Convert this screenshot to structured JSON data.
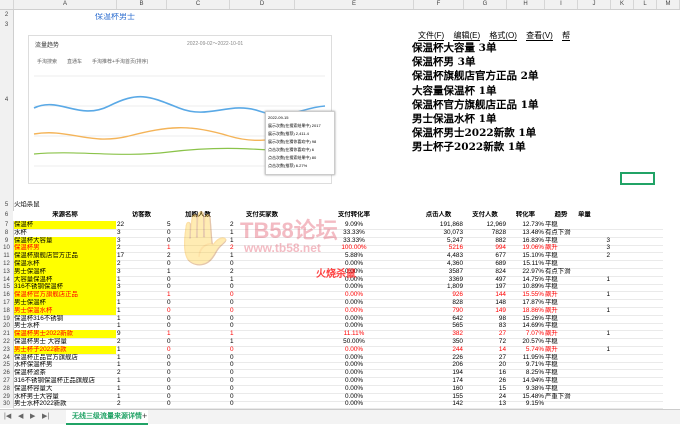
{
  "sheet": {
    "columns": [
      "A",
      "B",
      "C",
      "D",
      "E",
      "F",
      "G",
      "H",
      "I",
      "J",
      "K",
      "L",
      "M"
    ],
    "b2_title": "保温杯男士",
    "a6_label": "火焰杀鼠",
    "watermark_left": "火焰杀鼠",
    "watermark_center": "火烧杀鼠",
    "site_watermark_1": "TB58论坛",
    "site_watermark_2": "www.tb58.net"
  },
  "chart": {
    "title": "流量趋势",
    "date_range": "2022-09-02～2022-10-01",
    "legend": [
      "手淘搜索",
      "直通车",
      "手淘推荐+手淘首页(排序)"
    ],
    "tooltip_title": "2022-09-15",
    "tooltip_rows": [
      {
        "label": "展示次数(在搜索结果中)",
        "value": "2017"
      },
      {
        "label": "展示次数(推荐)",
        "value": "2,411.4"
      },
      {
        "label": "展示次数(在猜你喜欢中)",
        "value": "98"
      },
      {
        "label": "点击次数(在猜你喜欢中)",
        "value": "6"
      },
      {
        "label": "点击次数(在搜索结果中)",
        "value": "80"
      },
      {
        "label": "点击次数(推荐)",
        "value": "6.27%"
      }
    ]
  },
  "menu": [
    "文件(F)",
    "编辑(E)",
    "格式(O)",
    "查看(V)",
    "帮"
  ],
  "notes": [
    "保温杯大容量  3单",
    "保温杯男   3单",
    "保温杯旗舰店官方正品  2单",
    "大容量保温杯  1单",
    "保温杯官方旗舰店正品  1单",
    "男士保温水杯  1单",
    "保温杯男士2022新款  1单",
    "男士杯子2022新款  1单"
  ],
  "headers": {
    "source": "来源名称",
    "visitors": "访客数",
    "cart": "加购人数",
    "buyers": "支付买家数",
    "conv": "支付转化率",
    "clicks": "点击人数",
    "pay_amount": "支付人数",
    "rate": "转化率",
    "trend": "趋势",
    "orders": "单量"
  },
  "rows": [
    {
      "n": "7",
      "source": "保温杯",
      "visitors": "22",
      "cart": "5",
      "buyers": "2",
      "conv": "9.09%",
      "clicks": "191,868",
      "pay": "12,969",
      "rate": "12.73%",
      "trend": "平稳",
      "orders": "",
      "hl": true,
      "red": false
    },
    {
      "n": "8",
      "source": "水杯",
      "visitors": "3",
      "cart": "0",
      "buyers": "1",
      "conv": "33.33%",
      "clicks": "30,073",
      "pay": "7828",
      "rate": "13.48%",
      "trend": "有点下滑",
      "orders": "",
      "hl": false,
      "red": false
    },
    {
      "n": "9",
      "source": "保温杯大容量",
      "visitors": "3",
      "cart": "0",
      "buyers": "1",
      "conv": "33.33%",
      "clicks": "5,247",
      "pay": "882",
      "rate": "16.83%",
      "trend": "平稳",
      "orders": "3",
      "hl": true,
      "red": false
    },
    {
      "n": "10",
      "source": "保温杯男",
      "visitors": "2",
      "cart": "1",
      "buyers": "2",
      "conv": "100.00%",
      "clicks": "5216",
      "pay": "994",
      "rate": "19.06%",
      "trend": "飙升",
      "orders": "3",
      "hl": true,
      "red": true
    },
    {
      "n": "11",
      "source": "保温杯旗舰店官方正品",
      "visitors": "17",
      "cart": "2",
      "buyers": "1",
      "conv": "5.88%",
      "clicks": "4,483",
      "pay": "677",
      "rate": "15.10%",
      "trend": "平稳",
      "orders": "2",
      "hl": true,
      "red": false
    },
    {
      "n": "12",
      "source": "保温水杯",
      "visitors": "2",
      "cart": "0",
      "buyers": "0",
      "conv": "0.00%",
      "clicks": "4,360",
      "pay": "689",
      "rate": "15.11%",
      "trend": "平稳",
      "orders": "",
      "hl": true,
      "red": false
    },
    {
      "n": "13",
      "source": "男士保温杯",
      "visitors": "3",
      "cart": "1",
      "buyers": "2",
      "conv": "0.00%",
      "clicks": "3587",
      "pay": "824",
      "rate": "22.97%",
      "trend": "有点下滑",
      "orders": "",
      "hl": true,
      "red": false
    },
    {
      "n": "14",
      "source": "大容量保温杯",
      "visitors": "1",
      "cart": "0",
      "buyers": "1",
      "conv": "0.00%",
      "clicks": "3369",
      "pay": "497",
      "rate": "14.75%",
      "trend": "平稳",
      "orders": "1",
      "hl": true,
      "red": false
    },
    {
      "n": "15",
      "source": "316不锈钢保温杯",
      "visitors": "3",
      "cart": "0",
      "buyers": "0",
      "conv": "0.00%",
      "clicks": "1,809",
      "pay": "197",
      "rate": "10.89%",
      "trend": "平稳",
      "orders": "",
      "hl": true,
      "red": false
    },
    {
      "n": "16",
      "source": "保温杯官方旗舰店正品",
      "visitors": "3",
      "cart": "1",
      "buyers": "0",
      "conv": "0.00%",
      "clicks": "926",
      "pay": "144",
      "rate": "15.55%",
      "trend": "飙升",
      "orders": "1",
      "hl": true,
      "red": true
    },
    {
      "n": "17",
      "source": "男士保温杯",
      "visitors": "1",
      "cart": "0",
      "buyers": "0",
      "conv": "0.00%",
      "clicks": "828",
      "pay": "148",
      "rate": "17.87%",
      "trend": "平稳",
      "orders": "",
      "hl": true,
      "red": false
    },
    {
      "n": "18",
      "source": "男士保温水杯",
      "visitors": "1",
      "cart": "0",
      "buyers": "0",
      "conv": "0.00%",
      "clicks": "790",
      "pay": "149",
      "rate": "18.86%",
      "trend": "飙升",
      "orders": "1",
      "hl": true,
      "red": true
    },
    {
      "n": "19",
      "source": "保温杯316不锈钢",
      "visitors": "1",
      "cart": "0",
      "buyers": "0",
      "conv": "0.00%",
      "clicks": "642",
      "pay": "98",
      "rate": "15.26%",
      "trend": "平稳",
      "orders": "",
      "hl": false,
      "red": false
    },
    {
      "n": "20",
      "source": "男士水杯",
      "visitors": "1",
      "cart": "0",
      "buyers": "0",
      "conv": "0.00%",
      "clicks": "565",
      "pay": "83",
      "rate": "14.69%",
      "trend": "平稳",
      "orders": "",
      "hl": false,
      "red": false
    },
    {
      "n": "21",
      "source": "保温杯男士2022新款",
      "visitors": "9",
      "cart": "1",
      "buyers": "1",
      "conv": "11.11%",
      "clicks": "382",
      "pay": "27",
      "rate": "7.07%",
      "trend": "飙升",
      "orders": "1",
      "hl": true,
      "red": true
    },
    {
      "n": "22",
      "source": "保温杯男士 大容量",
      "visitors": "2",
      "cart": "0",
      "buyers": "1",
      "conv": "50.00%",
      "clicks": "350",
      "pay": "72",
      "rate": "20.57%",
      "trend": "平稳",
      "orders": "",
      "hl": false,
      "red": false
    },
    {
      "n": "23",
      "source": "男士杯子2022新款",
      "visitors": "1",
      "cart": "0",
      "buyers": "0",
      "conv": "0.00%",
      "clicks": "244",
      "pay": "14",
      "rate": "5.74%",
      "trend": "飙升",
      "orders": "1",
      "hl": true,
      "red": true
    },
    {
      "n": "24",
      "source": "保温杯正品官方旗舰店",
      "visitors": "1",
      "cart": "0",
      "buyers": "0",
      "conv": "0.00%",
      "clicks": "226",
      "pay": "27",
      "rate": "11.95%",
      "trend": "平稳",
      "orders": "",
      "hl": false,
      "red": false
    },
    {
      "n": "25",
      "source": "水杯保温杯男",
      "visitors": "1",
      "cart": "0",
      "buyers": "0",
      "conv": "0.00%",
      "clicks": "206",
      "pay": "20",
      "rate": "9.71%",
      "trend": "平稳",
      "orders": "",
      "hl": false,
      "red": false
    },
    {
      "n": "26",
      "source": "保温杯滤茶",
      "visitors": "2",
      "cart": "0",
      "buyers": "0",
      "conv": "0.00%",
      "clicks": "194",
      "pay": "16",
      "rate": "8.25%",
      "trend": "平稳",
      "orders": "",
      "hl": false,
      "red": false
    },
    {
      "n": "27",
      "source": "316不锈钢保温杯正品旗舰店",
      "visitors": "1",
      "cart": "0",
      "buyers": "0",
      "conv": "0.00%",
      "clicks": "174",
      "pay": "26",
      "rate": "14.94%",
      "trend": "平稳",
      "orders": "",
      "hl": false,
      "red": false
    },
    {
      "n": "28",
      "source": "保温杯容量大",
      "visitors": "1",
      "cart": "0",
      "buyers": "0",
      "conv": "0.00%",
      "clicks": "160",
      "pay": "15",
      "rate": "9.38%",
      "trend": "平稳",
      "orders": "",
      "hl": false,
      "red": false
    },
    {
      "n": "29",
      "source": "水杯男士大容量",
      "visitors": "1",
      "cart": "0",
      "buyers": "0",
      "conv": "0.00%",
      "clicks": "155",
      "pay": "24",
      "rate": "15.48%",
      "trend": "严重下滑",
      "orders": "",
      "hl": false,
      "red": false
    },
    {
      "n": "30",
      "source": "男士水杯2022新款",
      "visitors": "2",
      "cart": "0",
      "buyers": "0",
      "conv": "0.00%",
      "clicks": "142",
      "pay": "13",
      "rate": "9.15%",
      "trend": "",
      "orders": "",
      "hl": false,
      "red": false
    }
  ],
  "tabs": {
    "active": "无线三级流量来源详情",
    "add": "+"
  },
  "colors": {
    "highlight": "#ffff00",
    "red": "#ff0000",
    "selection": "#21a366",
    "rose": "#e0546a"
  }
}
